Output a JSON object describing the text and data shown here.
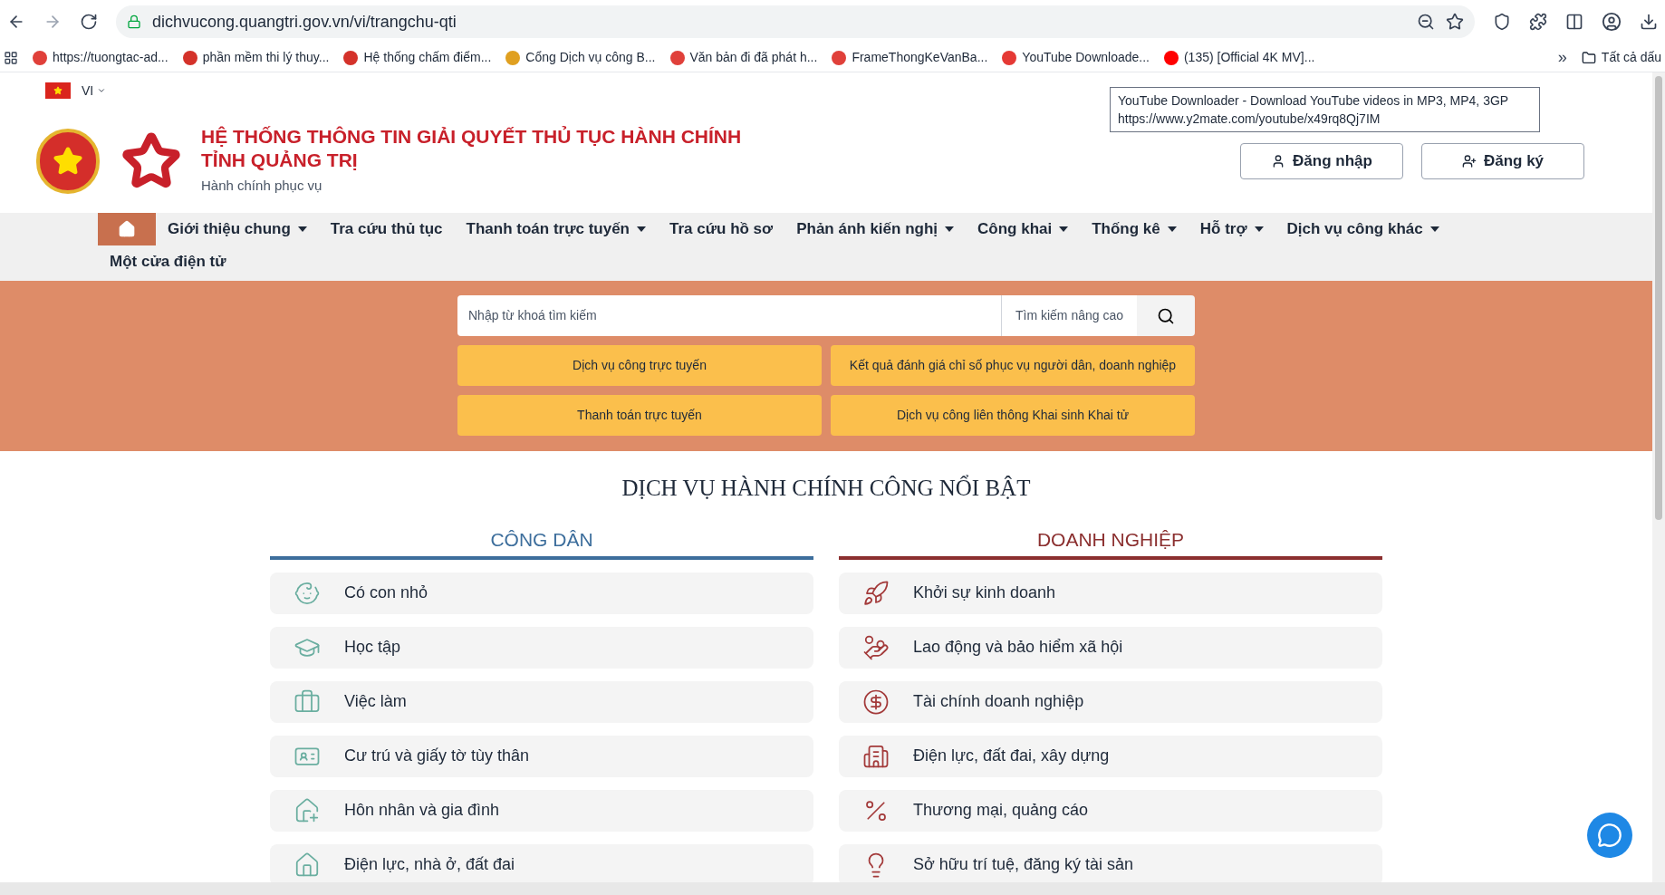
{
  "browser": {
    "url": "dichvucong.quangtri.gov.vn/vi/trangchu-qti",
    "bookmarks": [
      {
        "label": "https://tuongtac-ad...",
        "color": "#e0403a"
      },
      {
        "label": "phần mềm thi lý thuy...",
        "color": "#d4322a"
      },
      {
        "label": "Hệ thống chấm điểm...",
        "color": "#d4322a"
      },
      {
        "label": "Cổng Dịch vụ công B...",
        "color": "#e0a020"
      },
      {
        "label": "Văn bản đi đã phát h...",
        "color": "#e0403a"
      },
      {
        "label": "FrameThongKeVanBa...",
        "color": "#e0403a"
      },
      {
        "label": "YouTube Downloade...",
        "color": "#e53935"
      },
      {
        "label": "(135) [Official 4K MV]...",
        "color": "#ff0000"
      }
    ],
    "overflow": "»",
    "all_bookmarks": "Tất cả dấu",
    "tooltip": {
      "title": "YouTube Downloader - Download YouTube videos in MP3, MP4, 3GP",
      "url": "https://www.y2mate.com/youtube/x49rq8Qj7IM"
    }
  },
  "language": "VI",
  "header": {
    "title_line_1": "HỆ THỐNG THÔNG TIN GIẢI QUYẾT THỦ TỤC HÀNH CHÍNH",
    "title_line_2": "TỈNH QUẢNG TRỊ",
    "subtitle": "Hành chính phục vụ",
    "login": "Đăng nhập",
    "register": "Đăng ký"
  },
  "nav": [
    {
      "label": "Giới thiệu chung",
      "dropdown": true
    },
    {
      "label": "Tra cứu thủ tục",
      "dropdown": false
    },
    {
      "label": "Thanh toán trực tuyến",
      "dropdown": true
    },
    {
      "label": "Tra cứu hồ sơ",
      "dropdown": false
    },
    {
      "label": "Phản ánh kiến nghị",
      "dropdown": true
    },
    {
      "label": "Công khai",
      "dropdown": true
    },
    {
      "label": "Thống kê",
      "dropdown": true
    },
    {
      "label": "Hỗ trợ",
      "dropdown": true
    },
    {
      "label": "Dịch vụ công khác",
      "dropdown": true
    },
    {
      "label": "Một cửa điện tử",
      "dropdown": false
    }
  ],
  "search": {
    "placeholder": "Nhập từ khoá tìm kiếm",
    "advanced": "Tìm kiếm nâng cao"
  },
  "quick_links": [
    "Dịch vụ công trực tuyến",
    "Kết quả đánh giá chỉ số phục vụ người dân, doanh nghiệp",
    "Thanh toán trực tuyến",
    "Dịch vụ công liên thông Khai sinh Khai tử"
  ],
  "section_title": "DỊCH VỤ HÀNH CHÍNH CÔNG NỔI BẬT",
  "columns": [
    {
      "title": "CÔNG DÂN",
      "color": "#3d6e9c",
      "items": [
        {
          "label": "Có con nhỏ"
        },
        {
          "label": "Học tập"
        },
        {
          "label": "Việc làm"
        },
        {
          "label": "Cư trú và giấy tờ tùy thân"
        },
        {
          "label": "Hôn nhân và gia đình"
        },
        {
          "label": "Điện lực, nhà ở, đất đai"
        }
      ]
    },
    {
      "title": "DOANH NGHIỆP",
      "color": "#8b2f2f",
      "items": [
        {
          "label": "Khởi sự kinh doanh"
        },
        {
          "label": "Lao động và bảo hiểm xã hội"
        },
        {
          "label": "Tài chính doanh nghiệp"
        },
        {
          "label": "Điện lực, đất đai, xây dựng"
        },
        {
          "label": "Thương mại, quảng cáo"
        },
        {
          "label": "Sở hữu trí tuệ, đăng ký tài sản"
        }
      ]
    }
  ]
}
